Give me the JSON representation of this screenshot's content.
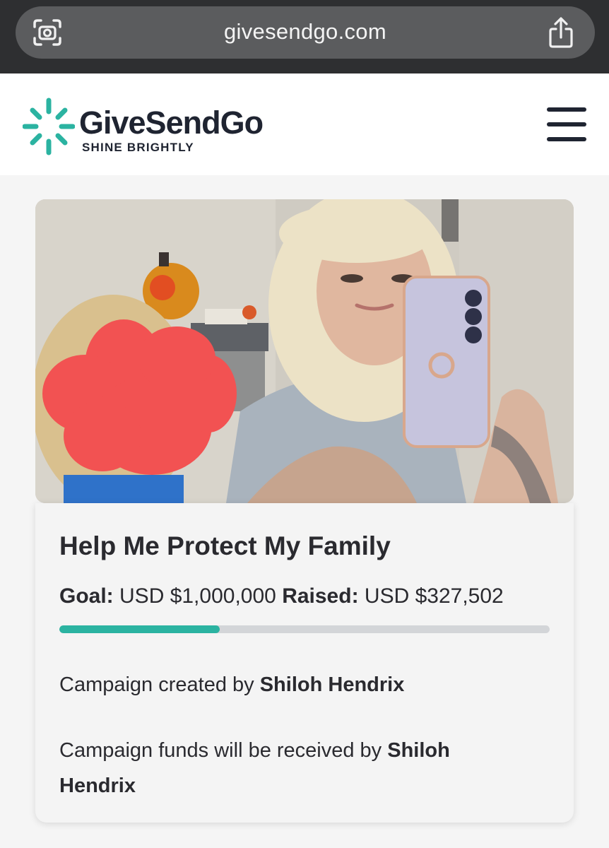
{
  "browser": {
    "url": "givesendgo.com",
    "left_icon": "camera-scan-icon",
    "right_icon": "share-icon"
  },
  "site": {
    "brand": "GiveSendGo",
    "tagline": "SHINE BRIGHTLY",
    "logo_icon": "starburst-logo-icon",
    "menu_icon": "hamburger-menu-icon",
    "brand_color": "#1f2431",
    "accent_color": "#2bb3a1"
  },
  "campaign": {
    "image_alt": "Photo of a woman taking a mirror selfie with a child whose face is covered by a red scribble",
    "title": "Help Me Protect My Family",
    "goal_label": "Goal:",
    "goal_value": "USD $1,000,000",
    "raised_label": "Raised:",
    "raised_value": "USD $327,502",
    "progress_fraction": 0.327502,
    "created_by_prefix": "Campaign created by",
    "created_by_name": "Shiloh Hendrix",
    "funds_prefix": "Campaign funds will be received by",
    "funds_name": "Shiloh Hendrix"
  }
}
